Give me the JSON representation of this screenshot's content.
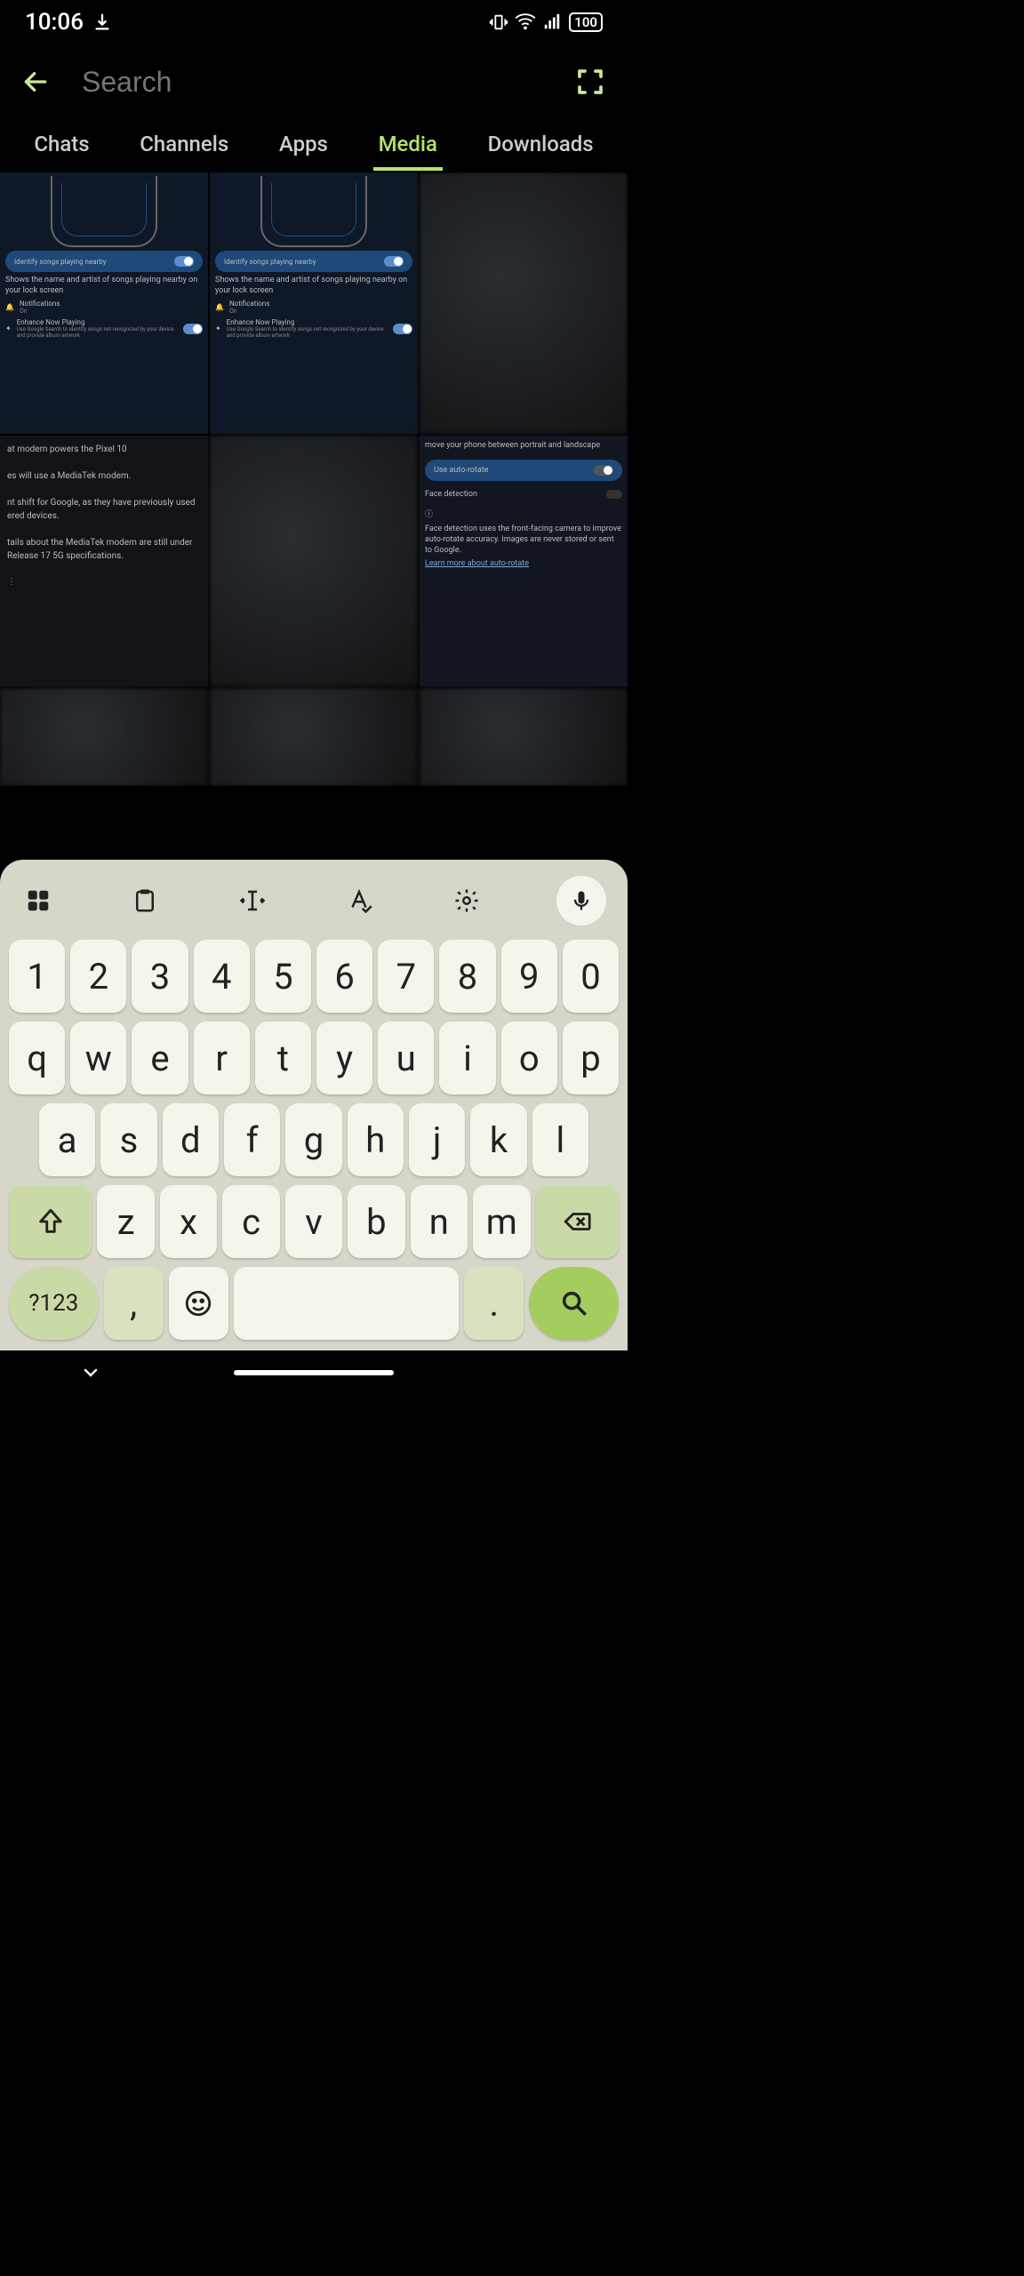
{
  "status": {
    "time": "10:06",
    "battery": "100"
  },
  "header": {
    "search_placeholder": "Search"
  },
  "tabs": {
    "chats": "Chats",
    "channels": "Channels",
    "apps": "Apps",
    "media": "Media",
    "downloads": "Downloads"
  },
  "media": {
    "tile1": {
      "identify": "Identify songs playing nearby",
      "desc": "Shows the name and artist of songs playing nearby on your lock screen",
      "notifications": "Notifications",
      "notifications_state": "On",
      "enhance": "Enhance Now Playing",
      "enhance_desc": "Use Google Search to identify songs not recognized by your device and provide album artwork"
    },
    "tile2": {
      "identify": "Identify songs playing nearby",
      "desc": "Shows the name and artist of songs playing nearby on your lock screen",
      "notifications": "Notifications",
      "notifications_state": "On",
      "enhance": "Enhance Now Playing",
      "enhance_desc": "Use Google Search to identify songs not recognized by your device and provide album artwork"
    },
    "tile4": {
      "line1": "at modem powers the Pixel 10",
      "line2": "es will use a MediaTek modem.",
      "line3": "nt shift for Google, as they have previously used",
      "line4": "ered devices.",
      "line5": "tails about the MediaTek modem are still under",
      "line6": "Release 17 5G specifications."
    },
    "tile6": {
      "top": "move your phone between portrait and landscape",
      "setting": "Use auto-rotate",
      "face": "Face detection",
      "desc": "Face detection uses the front-facing camera to improve auto-rotate accuracy. Images are never stored or sent to Google.",
      "link": "Learn more about auto-rotate"
    }
  },
  "keyboard": {
    "row1": [
      "1",
      "2",
      "3",
      "4",
      "5",
      "6",
      "7",
      "8",
      "9",
      "0"
    ],
    "row2": [
      "q",
      "w",
      "e",
      "r",
      "t",
      "y",
      "u",
      "i",
      "o",
      "p"
    ],
    "row3": [
      "a",
      "s",
      "d",
      "f",
      "g",
      "h",
      "j",
      "k",
      "l"
    ],
    "row4": [
      "z",
      "x",
      "c",
      "v",
      "b",
      "n",
      "m"
    ],
    "sym": "?123",
    "comma": ",",
    "period": "."
  }
}
